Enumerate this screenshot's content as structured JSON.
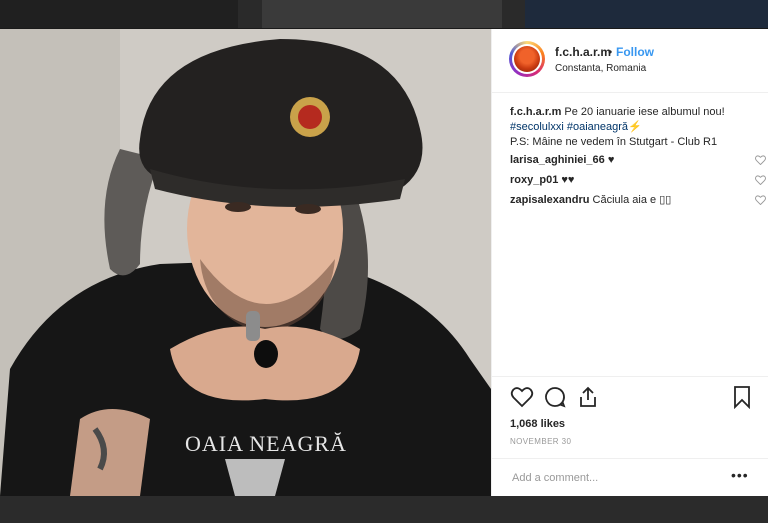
{
  "post": {
    "username": "f.c.h.a.r.m",
    "separator": "•",
    "follow_label": "Follow",
    "location": "Constanta, Romania",
    "caption": {
      "username": "f.c.h.a.r.m",
      "text_line1": "Pe 20 ianuarie iese albumul nou!",
      "hashtag1": "#secolulxxi",
      "hashtag2": "#oaianeagră",
      "emoji": "⚡",
      "text_line3": "P.S: Mâine ne vedem în Stutgart - Club R1"
    },
    "comments": [
      {
        "user": "larisa_aghiniei_66",
        "text": "♥"
      },
      {
        "user": "roxy_p01",
        "text": "♥♥"
      },
      {
        "user": "zapisalexandru",
        "text": "Căciula aia e ▯▯"
      }
    ],
    "likes": "1,068 likes",
    "date": "NOVEMBER 30",
    "comment_placeholder": "Add a comment...",
    "more_label": "•••"
  },
  "photo": {
    "shirt_text": "OAIA NEAGRĂ"
  },
  "icons": {
    "like": "heart-icon",
    "comment": "comment-icon",
    "share": "share-icon",
    "save": "bookmark-icon",
    "comment_like": "heart-icon-small"
  },
  "colors": {
    "link": "#3897f0",
    "hashtag": "#003569",
    "text": "#262626",
    "muted": "#999999"
  }
}
